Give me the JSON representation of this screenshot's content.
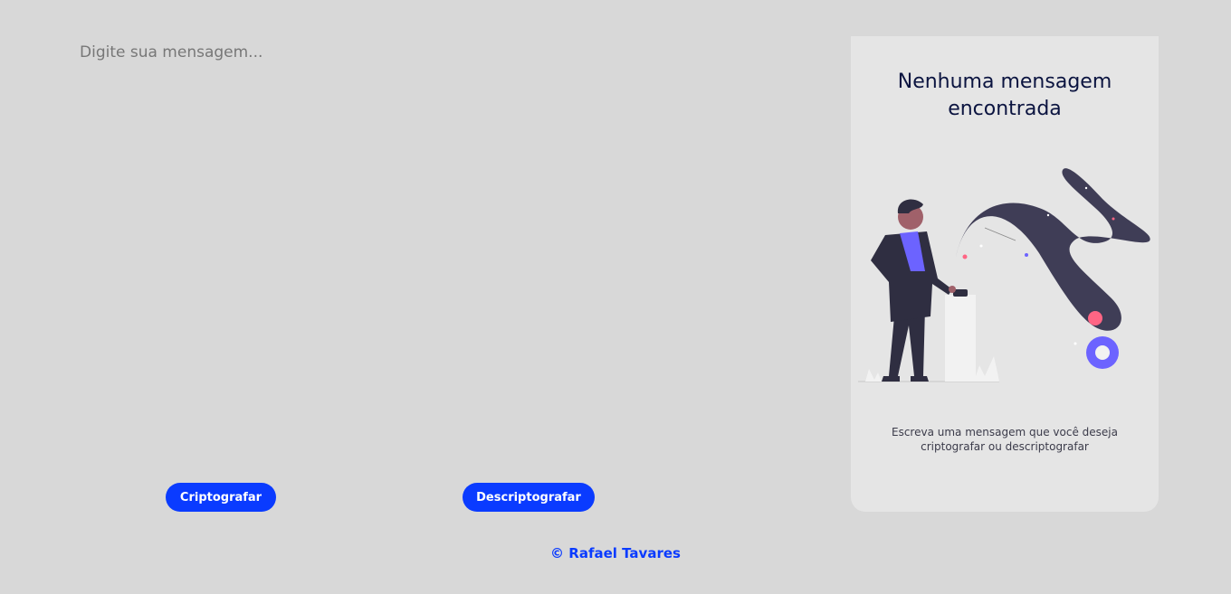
{
  "input": {
    "placeholder": "Digite sua mensagem..."
  },
  "buttons": {
    "encrypt_label": "Criptografar",
    "decrypt_label": "Descriptografar"
  },
  "panel": {
    "title": "Nenhuma mensagem encontrada",
    "description": "Escreva uma mensagem que você deseja criptografar ou descriptografar"
  },
  "footer": {
    "text": "© Rafael Tavares"
  },
  "colors": {
    "background": "#d8d8d8",
    "accent": "#0a3bff",
    "panel": "#e5e5e5",
    "illustration_purple": "#6c63ff",
    "illustration_dark": "#3f3d56"
  }
}
